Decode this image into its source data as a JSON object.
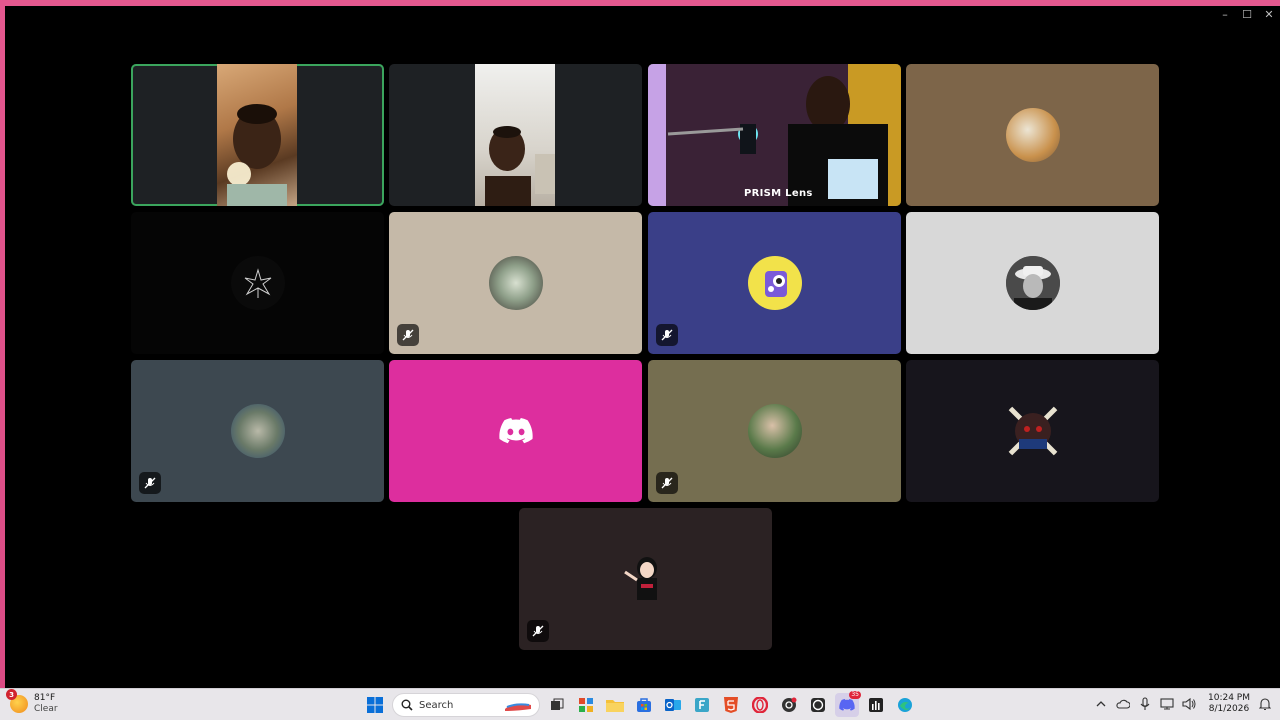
{
  "window": {
    "controls": [
      "–",
      "☐",
      "✕"
    ]
  },
  "tiles": [
    {
      "id": "t1",
      "kind": "video",
      "speaking": true,
      "bg": "#1e2124"
    },
    {
      "id": "t2",
      "kind": "video",
      "speaking": false,
      "bg": "#1e2124"
    },
    {
      "id": "t3",
      "kind": "video",
      "speaking": true,
      "bg": "#2a1a2e",
      "overlay_label": "PRISM Lens"
    },
    {
      "id": "t4",
      "kind": "avatar",
      "bg": "#7d6549",
      "muted": false
    },
    {
      "id": "t5",
      "kind": "avatar",
      "bg": "#050505",
      "muted": false
    },
    {
      "id": "t6",
      "kind": "avatar",
      "bg": "#c5b9a8",
      "muted": true
    },
    {
      "id": "t7",
      "kind": "avatar",
      "bg": "#3a3f88",
      "muted": true
    },
    {
      "id": "t8",
      "kind": "avatar",
      "bg": "#d8d8d8",
      "muted": false
    },
    {
      "id": "t9",
      "kind": "avatar",
      "bg": "#3d4850",
      "muted": true
    },
    {
      "id": "t10",
      "kind": "discord-logo",
      "bg": "#dd2e9e",
      "muted": false
    },
    {
      "id": "t11",
      "kind": "avatar",
      "bg": "#756e50",
      "muted": true
    },
    {
      "id": "t12",
      "kind": "avatar",
      "bg": "#17151c",
      "muted": false
    },
    {
      "id": "t13",
      "kind": "avatar",
      "bg": "#2b2223",
      "muted": true
    }
  ],
  "taskbar": {
    "weather": {
      "temp": "81°F",
      "condition": "Clear",
      "badge": "3"
    },
    "search_placeholder": "Search",
    "clock": {
      "time": "10:24 PM",
      "date": "8/1/2026"
    },
    "discord_badge": "35"
  }
}
